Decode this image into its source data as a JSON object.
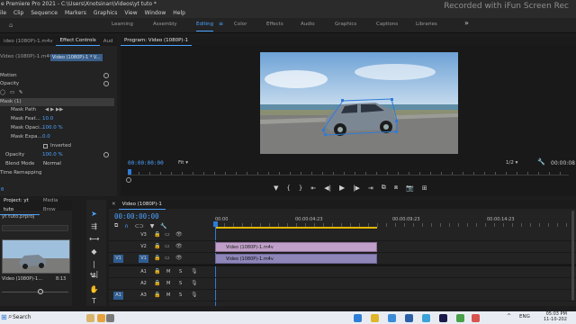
{
  "window": {
    "title": "e Premiere Pro 2021 - C:\\Users\\Xnotsinan\\Videos\\yt tuto *",
    "watermark": "Recorded with iFun Screen Rec"
  },
  "menu": [
    "ile",
    "Clip",
    "Sequence",
    "Markers",
    "Graphics",
    "View",
    "Window",
    "Help"
  ],
  "workspaces": {
    "items": [
      "Learning",
      "Assembly",
      "Editing",
      "Color",
      "Effects",
      "Audio",
      "Graphics",
      "Captions",
      "Libraries"
    ],
    "active": "Editing",
    "more": "»"
  },
  "left_panel": {
    "tabs": [
      "ideo (1080P)-1.m4v",
      "Effect Controls",
      "Aud"
    ],
    "source_label": "Video (1080P)-1.m4v",
    "clip_label": "Video (1080P)-1 * V...",
    "rows": {
      "motion": "Motion",
      "opacity_section": "Opacity",
      "mask": "Mask (1)",
      "mask_path": "Mask Path",
      "mask_feather": "Mask Feat...",
      "mask_feather_value": "10.0",
      "mask_opacity": "Mask Opaci...",
      "mask_opacity_value": "100.0 %",
      "mask_expansion": "Mask Expa...",
      "mask_expansion_value": "0.0",
      "inverted": "Inverted",
      "opacity": "Opacity",
      "opacity_value": "100.0 %",
      "blend_mode": "Blend Mode",
      "blend_mode_value": "Normal",
      "time_remapping": "Time Remapping"
    },
    "timecode": "0"
  },
  "program": {
    "title": "Program: Video (1080P)-1",
    "timecode": "00:00:00:00",
    "fit": "Fit",
    "resolution": "1/2",
    "end_timecode": "00:00:08"
  },
  "project": {
    "tab_label": "Project: yt tuto",
    "media_tab": "Media Brow",
    "file_label": "yt tuto.prproj",
    "clip_name": "Video (1080P)-1...",
    "clip_duration": "8:13"
  },
  "timeline": {
    "tab_label": "Video (1080P)-1",
    "timecode": "00:00:00:00",
    "ruler": [
      "00:00",
      "00:00:04:23",
      "00:00:09:23",
      "00:00:14:23"
    ],
    "tracks": [
      {
        "source": "",
        "name": "V3"
      },
      {
        "source": "",
        "name": "V2"
      },
      {
        "source": "V1",
        "name": "V1"
      },
      {
        "source": "",
        "name": "A1"
      },
      {
        "source": "",
        "name": "A2"
      },
      {
        "source": "A1",
        "name": "A3"
      }
    ],
    "clips": {
      "v2": "Video (1080P)-1.m4v",
      "v1": "Video (1080P)-1.m4v"
    },
    "track_letters": {
      "mute": "M",
      "solo": "S"
    }
  },
  "taskbar": {
    "search": "Search",
    "time": "05:03 PM",
    "date": "11-10-202",
    "lang": "ENG"
  },
  "colors": {
    "accent": "#4aa3ff",
    "clip_video": "#c0a0c8",
    "clip_audio": "#5d8fbf",
    "playhead": "#2f7bd8"
  }
}
